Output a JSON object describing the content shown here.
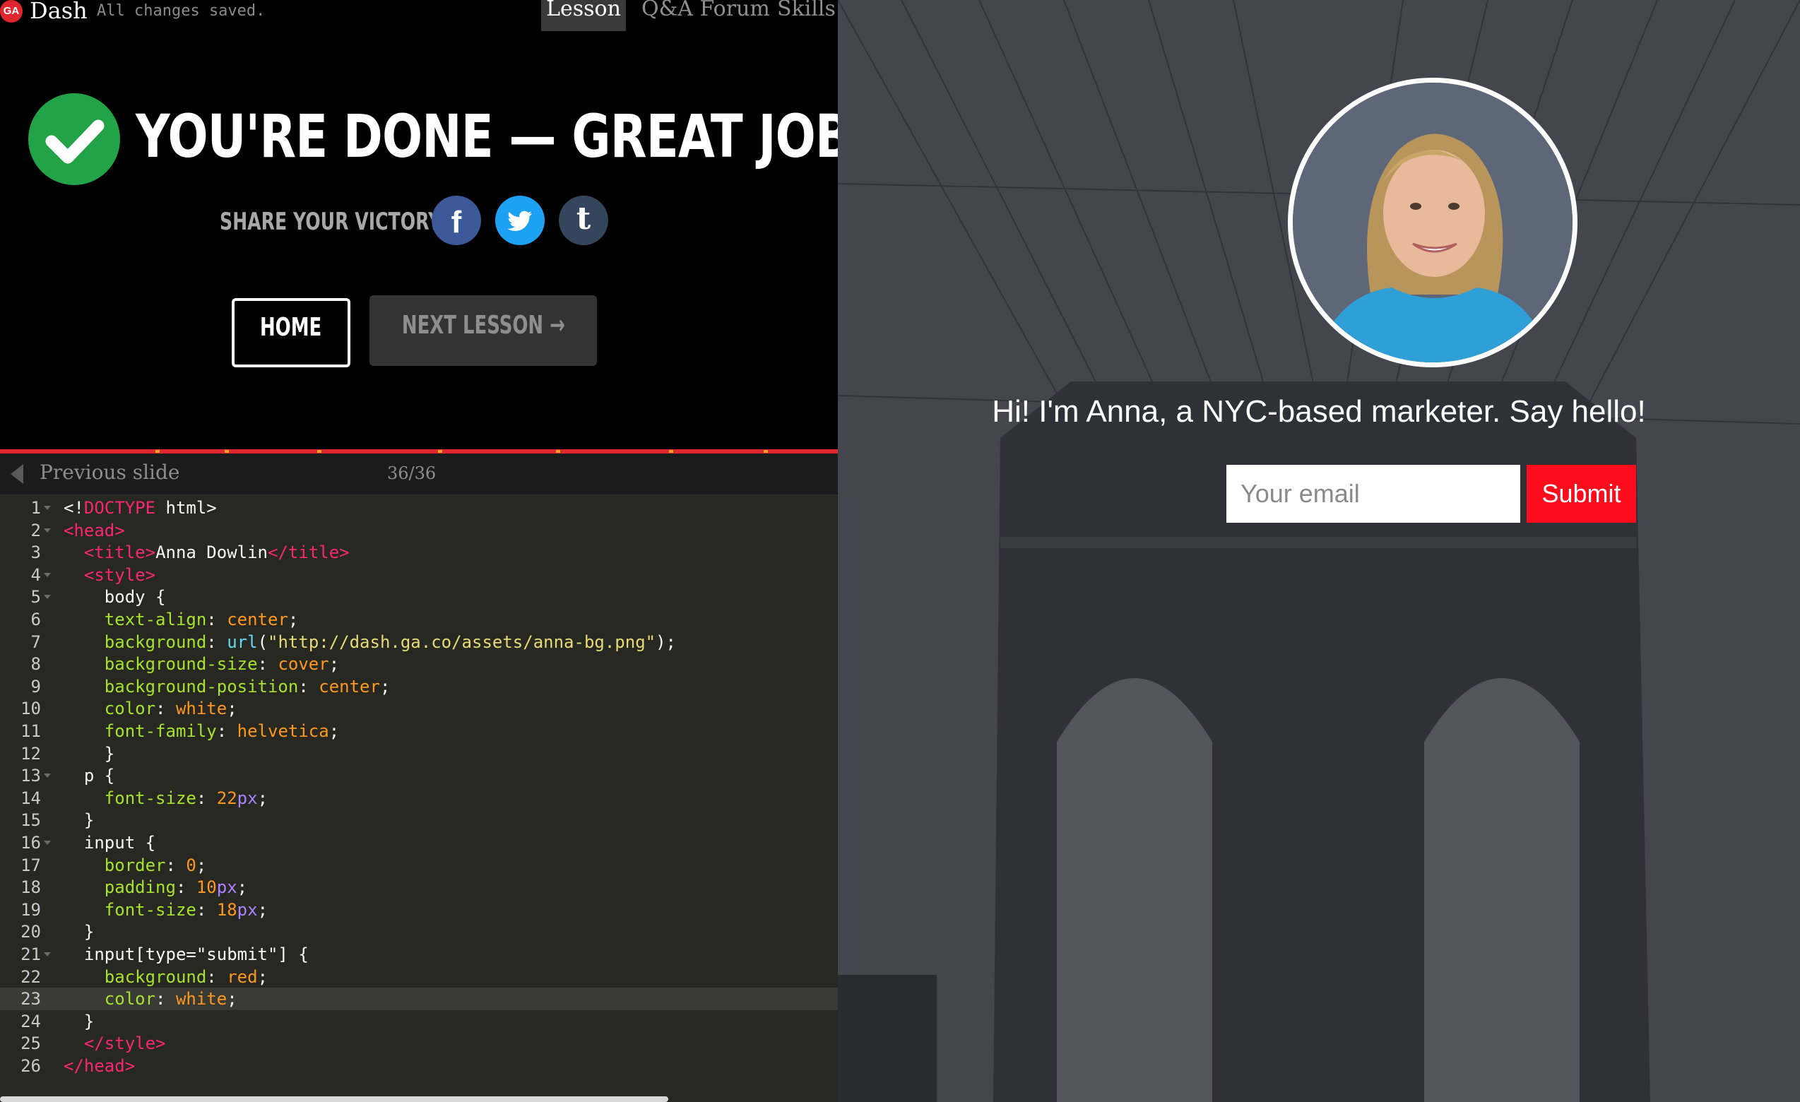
{
  "topbar": {
    "logo": "GA",
    "app_name": "Dash",
    "save_status": "All changes saved.",
    "tabs": [
      "Lesson",
      "Q&A Forum",
      "Skills"
    ],
    "active_tab": "Lesson"
  },
  "done_panel": {
    "title": "YOU'RE DONE — GREAT JOB!",
    "share_label": "SHARE YOUR VICTORY:",
    "share_icons": [
      "facebook-icon",
      "twitter-icon",
      "tumblr-icon"
    ],
    "facebook_glyph": "f",
    "tumblr_glyph": "t",
    "home_label": "HOME",
    "next_label": "NEXT LESSON →",
    "check_color": "#22a347"
  },
  "slide_nav": {
    "prev_label": "Previous slide",
    "counter": "36/36"
  },
  "editor": {
    "active_line": 23,
    "lines": [
      "<!DOCTYPE html>",
      "<head>",
      "  <title>Anna Dowlin</title>",
      "  <style>",
      "    body {",
      "    text-align: center;",
      "    background: url(\"http://dash.ga.co/assets/anna-bg.png\");",
      "    background-size: cover;",
      "    background-position: center;",
      "    color: white;",
      "    font-family: helvetica;",
      "    }",
      "  p {",
      "    font-size: 22px;",
      "  }",
      "  input {",
      "    border: 0;",
      "    padding: 10px;",
      "    font-size: 18px;",
      "  }",
      "  input[type=\"submit\"] {",
      "    background: red;",
      "    color: white;",
      "  }",
      "  </style>",
      "</head>"
    ]
  },
  "preview": {
    "tagline": "Hi! I'm Anna, a NYC-based marketer. Say hello!",
    "email_placeholder": "Your email",
    "submit_label": "Submit",
    "submit_color": "#fd0d1b"
  }
}
